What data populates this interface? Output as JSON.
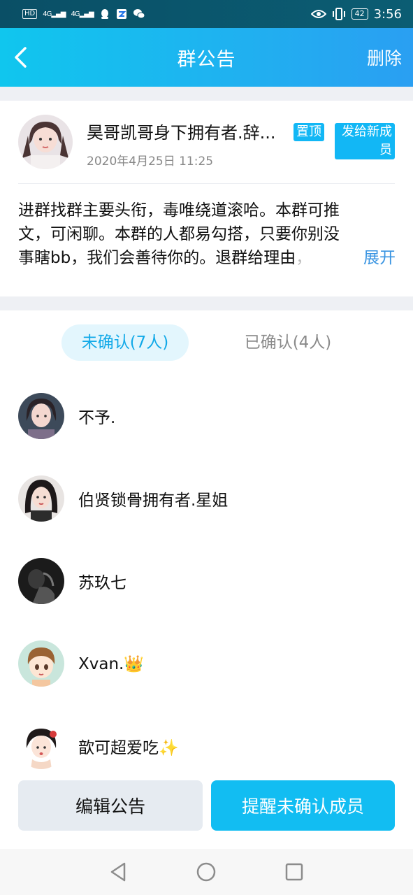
{
  "status_bar": {
    "left_chips": [
      "HD",
      "4G",
      "4G"
    ],
    "battery": "42",
    "time": "3:56"
  },
  "header": {
    "title": "群公告",
    "delete_label": "删除"
  },
  "announcement": {
    "author": "昊哥凯哥身下拥有者.辞...",
    "tag_top": "置顶",
    "tag_new_line1": "发给新成",
    "tag_new_line2": "员",
    "date": "2020年4月25日 11:25",
    "line1": "进群找群主要头衔，毒唯绕道滚哈。本群可推",
    "line2": "文，可闲聊。本群的人都易勾搭，只要你别没",
    "line3": "事瞎bb，我们会善待你的。退群给理由",
    "line3_fade": "，",
    "expand_label": "展开"
  },
  "tabs": {
    "unconfirmed": "未确认(7人)",
    "confirmed": "已确认(4人)"
  },
  "members": [
    {
      "name": "不予."
    },
    {
      "name": "伯贤锁骨拥有者.星姐"
    },
    {
      "name": "苏玖七"
    },
    {
      "name": "Xvan.👑"
    },
    {
      "name": "歆可超爱吃✨"
    }
  ],
  "actions": {
    "edit_label": "编辑公告",
    "remind_label": "提醒未确认成员"
  },
  "colors": {
    "accent": "#12b7f5",
    "link": "#3b95e2",
    "header_gradient_start": "#10c6ee",
    "header_gradient_end": "#2a9ff2"
  }
}
